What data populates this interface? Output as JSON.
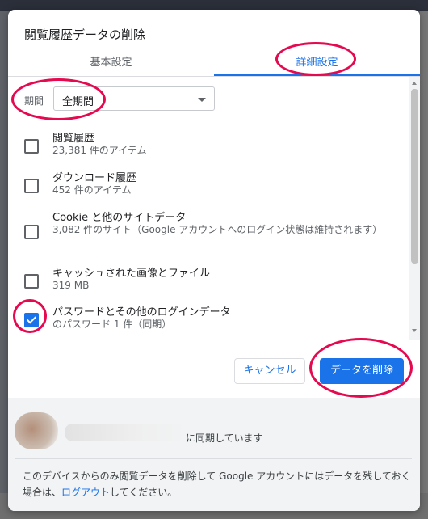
{
  "dialog": {
    "title": "閲覧履歴データの削除",
    "tabs": {
      "basic": "基本設定",
      "advanced": "詳細設定"
    },
    "period": {
      "label": "期間",
      "value": "全期間"
    },
    "items": [
      {
        "title": "閲覧履歴",
        "subtitle": "23,381 件のアイテム",
        "checked": false
      },
      {
        "title": "ダウンロード履歴",
        "subtitle": "452 件のアイテム",
        "checked": false
      },
      {
        "title": "Cookie と他のサイトデータ",
        "subtitle": "3,082 件のサイト（Google アカウントへのログイン状態は維持されます）",
        "checked": false
      },
      {
        "title": "キャッシュされた画像とファイル",
        "subtitle": "319 MB",
        "checked": false
      },
      {
        "title": "パスワードとその他のログインデータ",
        "subtitle": "のパスワード 1 件（同期）",
        "checked": true
      }
    ],
    "buttons": {
      "cancel": "キャンセル",
      "delete": "データを削除"
    },
    "sync": {
      "text": "に同期しています"
    },
    "footer": {
      "text_before": "このデバイスからのみ閲覧データを削除して Google アカウントにはデータを残しておく場合は、",
      "link": "ログアウト",
      "text_after": "してください。"
    }
  },
  "colors": {
    "accent": "#1a73e8",
    "highlight_ring": "#e5094f"
  }
}
